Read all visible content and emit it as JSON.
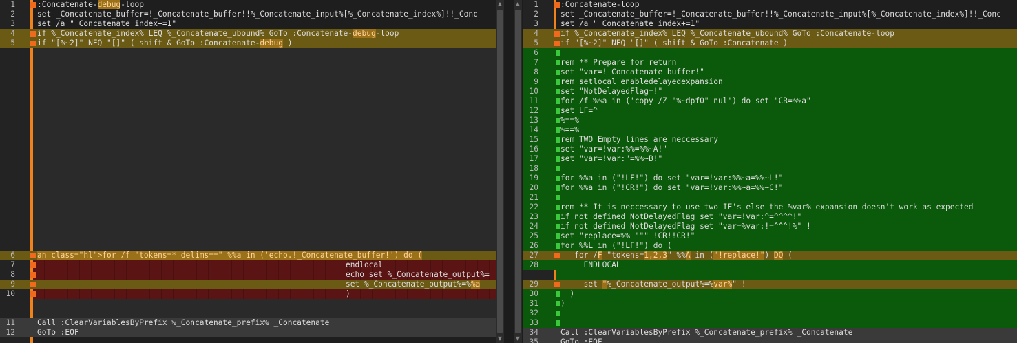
{
  "left": {
    "lines": [
      {
        "n": "1",
        "t": ":Concatenate-debug-loop",
        "bg": "none",
        "marker": "orange"
      },
      {
        "n": "2",
        "t": "set _Concatenate_buffer=!_Concatenate_buffer!!%_Concatenate_input%[%_Concatenate_index%]!!_Conc",
        "bg": "none",
        "marker": "none"
      },
      {
        "n": "3",
        "t": "set /a \"_Concatenate_index+=1\"",
        "bg": "none",
        "marker": "none"
      },
      {
        "n": "4",
        "t": "if %_Concatenate_index% LEQ %_Concatenate_ubound% GoTo :Concatenate-debug-loop",
        "bg": "yellow",
        "marker": "orange"
      },
      {
        "n": "5",
        "t": "if \"[%~2]\" NEQ \"[]\" ( shift & GoTo :Concatenate-debug )",
        "bg": "yellow",
        "marker": "orange"
      },
      {
        "n": "6",
        "t": "for /f \"tokens=* delims==\" %%a in ('echo.!_Concatenate_buffer!') do (",
        "bg": "yellow",
        "marker": "orange"
      },
      {
        "n": "7",
        "t": "endlocal",
        "bg": "none",
        "marker": "orange",
        "indent": true
      },
      {
        "n": "8",
        "t": "echo set %_Concatenate_output%=",
        "bg": "none",
        "marker": "orange",
        "indent": true
      },
      {
        "n": "9",
        "t": "set %_Concatenate_output%=%%a",
        "bg": "yellow",
        "marker": "orange",
        "indent": true
      },
      {
        "n": "10",
        "t": ")",
        "bg": "none",
        "marker": "orange",
        "indent": true
      },
      {
        "n": "11",
        "t": "Call :ClearVariablesByPrefix %_Concatenate_prefix% _Concatenate",
        "bg": "gray",
        "marker": "none"
      },
      {
        "n": "12",
        "t": "GoTo :EOF",
        "bg": "gray",
        "marker": "none"
      }
    ]
  },
  "right": {
    "lines": [
      {
        "n": "1",
        "t": ":Concatenate-loop",
        "bg": "none",
        "marker": "orange"
      },
      {
        "n": "2",
        "t": "set _Concatenate_buffer=!_Concatenate_buffer!!%_Concatenate_input%[%_Concatenate_index%]!!_Conc",
        "bg": "none",
        "marker": "none"
      },
      {
        "n": "3",
        "t": "set /a \"_Concatenate_index+=1\"",
        "bg": "none",
        "marker": "none"
      },
      {
        "n": "4",
        "t": "if %_Concatenate_index% LEQ %_Concatenate_ubound% GoTo :Concatenate-loop",
        "bg": "yellow",
        "marker": "orange"
      },
      {
        "n": "5",
        "t": "if \"[%~2]\" NEQ \"[]\" ( shift & GoTo :Concatenate )",
        "bg": "yellow",
        "marker": "orange"
      },
      {
        "n": "6",
        "t": "",
        "bg": "green",
        "marker": "green"
      },
      {
        "n": "7",
        "t": "rem ** Prepare for return",
        "bg": "green",
        "marker": "green"
      },
      {
        "n": "8",
        "t": "set \"var=!_Concatenate_buffer!\"",
        "bg": "green",
        "marker": "green"
      },
      {
        "n": "9",
        "t": "rem setlocal enabledelayedexpansion",
        "bg": "green",
        "marker": "green"
      },
      {
        "n": "10",
        "t": "set \"NotDelayedFlag=!\"",
        "bg": "green",
        "marker": "green"
      },
      {
        "n": "11",
        "t": "for /f %%a in ('copy /Z \"%~dpf0\" nul') do set \"CR=%%a\"",
        "bg": "green",
        "marker": "green"
      },
      {
        "n": "12",
        "t": "set LF=^",
        "bg": "green",
        "marker": "green"
      },
      {
        "n": "13",
        "t": "%==%",
        "bg": "green",
        "marker": "green"
      },
      {
        "n": "14",
        "t": "%==%",
        "bg": "green",
        "marker": "green"
      },
      {
        "n": "15",
        "t": "rem TWO Empty lines are neccessary",
        "bg": "green",
        "marker": "green"
      },
      {
        "n": "16",
        "t": "set \"var=!var:%%=%%~A!\"",
        "bg": "green",
        "marker": "green"
      },
      {
        "n": "17",
        "t": "set \"var=!var:\"=%%~B!\"",
        "bg": "green",
        "marker": "green"
      },
      {
        "n": "18",
        "t": "",
        "bg": "green",
        "marker": "green"
      },
      {
        "n": "19",
        "t": "for %%a in (\"!LF!\") do set \"var=!var:%%~a=%%~L!\"",
        "bg": "green",
        "marker": "green"
      },
      {
        "n": "20",
        "t": "for %%a in (\"!CR!\") do set \"var=!var:%%~a=%%~C!\"",
        "bg": "green",
        "marker": "green"
      },
      {
        "n": "21",
        "t": "",
        "bg": "green",
        "marker": "green"
      },
      {
        "n": "22",
        "t": "rem ** It is neccessary to use two IF's else the %var% expansion doesn't work as expected",
        "bg": "green",
        "marker": "green"
      },
      {
        "n": "23",
        "t": "if not defined NotDelayedFlag set \"var=!var:^=^^^^!\"",
        "bg": "green",
        "marker": "green"
      },
      {
        "n": "24",
        "t": "if not defined NotDelayedFlag set \"var=%var:!=^^^!%\" !",
        "bg": "green",
        "marker": "green"
      },
      {
        "n": "25",
        "t": "set \"replace=%% \"\"\" !CR!!CR!\"",
        "bg": "green",
        "marker": "green"
      },
      {
        "n": "26",
        "t": "for %%L in (\"!LF!\") do (",
        "bg": "green",
        "marker": "green"
      },
      {
        "n": "27",
        "t": "   for /F \"tokens=1,2,3\" %%A in (\"!replace!\") DO (",
        "bg": "yellow",
        "marker": "orange"
      },
      {
        "n": "28",
        "t": "     ENDLOCAL",
        "bg": "green",
        "marker": "none"
      },
      {
        "n": "29",
        "t": "     set \"%_Concatenate_output%=%var%\" !",
        "bg": "yellow",
        "marker": "orange"
      },
      {
        "n": "30",
        "t": "  )",
        "bg": "green",
        "marker": "green"
      },
      {
        "n": "31",
        "t": ")",
        "bg": "green",
        "marker": "green"
      },
      {
        "n": "32",
        "t": "",
        "bg": "green",
        "marker": "green"
      },
      {
        "n": "33",
        "t": "",
        "bg": "green",
        "marker": "green"
      },
      {
        "n": "34",
        "t": "Call :ClearVariablesByPrefix %_Concatenate_prefix% _Concatenate",
        "bg": "gray",
        "marker": "none"
      },
      {
        "n": "35",
        "t": "GoTo :EOF",
        "bg": "gray",
        "marker": "none"
      }
    ]
  },
  "colors": {
    "orange_bar": "#f0821e",
    "changed_line": "#6a5a14",
    "deleted_block": "#5a1414",
    "inserted_block": "#0b5a0b",
    "highlight": "#9a7018"
  }
}
